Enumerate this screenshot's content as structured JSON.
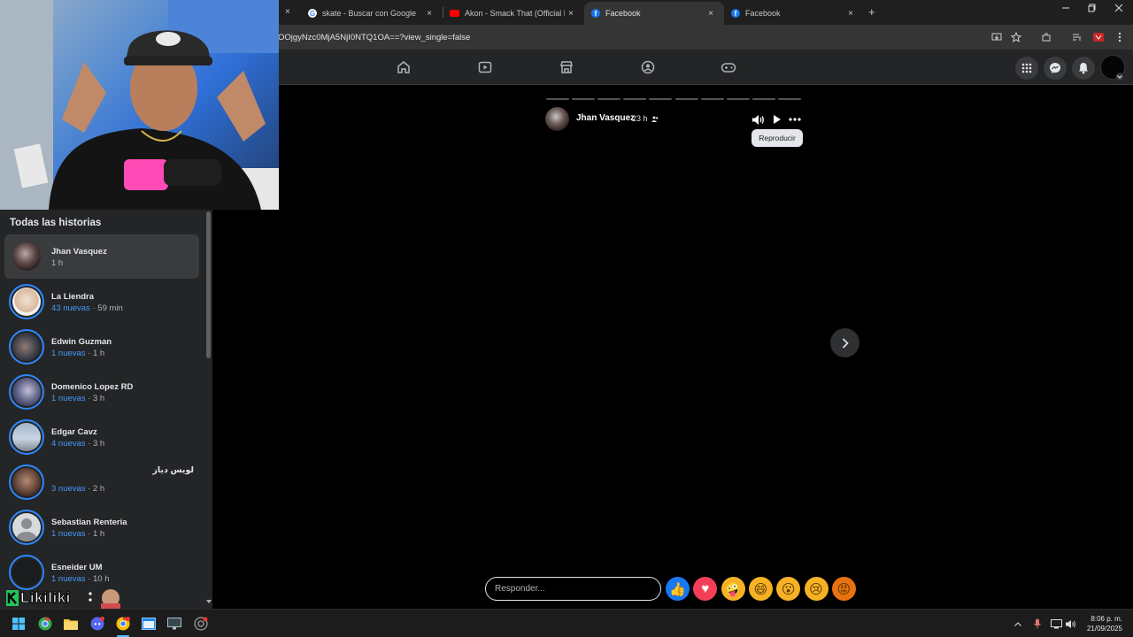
{
  "browser": {
    "tabs": [
      {
        "title": "skate - Buscar con Google",
        "favicon": "google-icon",
        "active": false
      },
      {
        "title": "Akon - Smack That (Official Mu",
        "favicon": "youtube-icon",
        "active": false
      },
      {
        "title": "Facebook",
        "favicon": "facebook-icon",
        "active": true
      },
      {
        "title": "Facebook",
        "favicon": "facebook-icon",
        "active": false
      }
    ],
    "new_tab_label": "+",
    "close_glyph": "×",
    "url": "OOjgyNzc0MjA5NjI0NTQ1OA==?view_single=false"
  },
  "sidebar": {
    "title": "Todas las historias",
    "stories": [
      {
        "name": "Jhan Vasquez",
        "new_count": "",
        "time": "1 h",
        "selected": true,
        "avatar_color": "#4a3b3b"
      },
      {
        "name": "La Liendra",
        "new_count": "43 nuevas",
        "time": "· 59 min",
        "selected": false,
        "avatar_color": "#e8d9c9"
      },
      {
        "name": "Edwin Guzman",
        "new_count": "1 nuevas",
        "time": "· 1 h",
        "selected": false,
        "avatar_color": "#3c3f4a"
      },
      {
        "name": "Domenico Lopez RD",
        "new_count": "1 nuevas",
        "time": "· 3 h",
        "selected": false,
        "avatar_color": "#6b7088"
      },
      {
        "name": "Edgar Cavz",
        "new_count": "4 nuevas",
        "time": "· 3 h",
        "selected": false,
        "avatar_color": "#b9c7d6"
      },
      {
        "name": "لويس دياز",
        "new_count": "3 nuevas",
        "time": "· 2 h",
        "selected": false,
        "avatar_color": "#6a4a3e"
      },
      {
        "name": "Sebastian Renteria",
        "new_count": "1 nuevas",
        "time": "· 1 h",
        "selected": false,
        "avatar_color": "#d9dadc"
      },
      {
        "name": "Esneider UM",
        "new_count": "1 nuevas",
        "time": "· 10 h",
        "selected": false,
        "avatar_color": "#1b1c1e"
      }
    ]
  },
  "stream_overlay": {
    "logo_text": "Likiliki"
  },
  "viewer": {
    "author": "Jhan Vasquez",
    "time": "23 h",
    "tooltip": "Reproducir",
    "reply_placeholder": "Responder...",
    "segments": 10,
    "reactions": [
      {
        "name": "like-reaction",
        "glyph": "👍",
        "bg": "#1877f2"
      },
      {
        "name": "love-reaction",
        "glyph": "♥",
        "bg": "#f33e58"
      },
      {
        "name": "care-reaction",
        "glyph": "🤪",
        "bg": "#f7b125"
      },
      {
        "name": "haha-reaction",
        "glyph": "😄",
        "bg": "#f7b125"
      },
      {
        "name": "wow-reaction",
        "glyph": "😮",
        "bg": "#f7b125"
      },
      {
        "name": "sad-reaction",
        "glyph": "😢",
        "bg": "#f7b125"
      },
      {
        "name": "angry-reaction",
        "glyph": "😡",
        "bg": "#e9710f"
      }
    ]
  },
  "taskbar": {
    "time": "8:06 p. m.",
    "date": "21/09/2025"
  },
  "colors": {
    "accent": "#2d88ff",
    "new_text": "#4599ff",
    "surface": "#242526",
    "hover": "#3a3b3c"
  }
}
